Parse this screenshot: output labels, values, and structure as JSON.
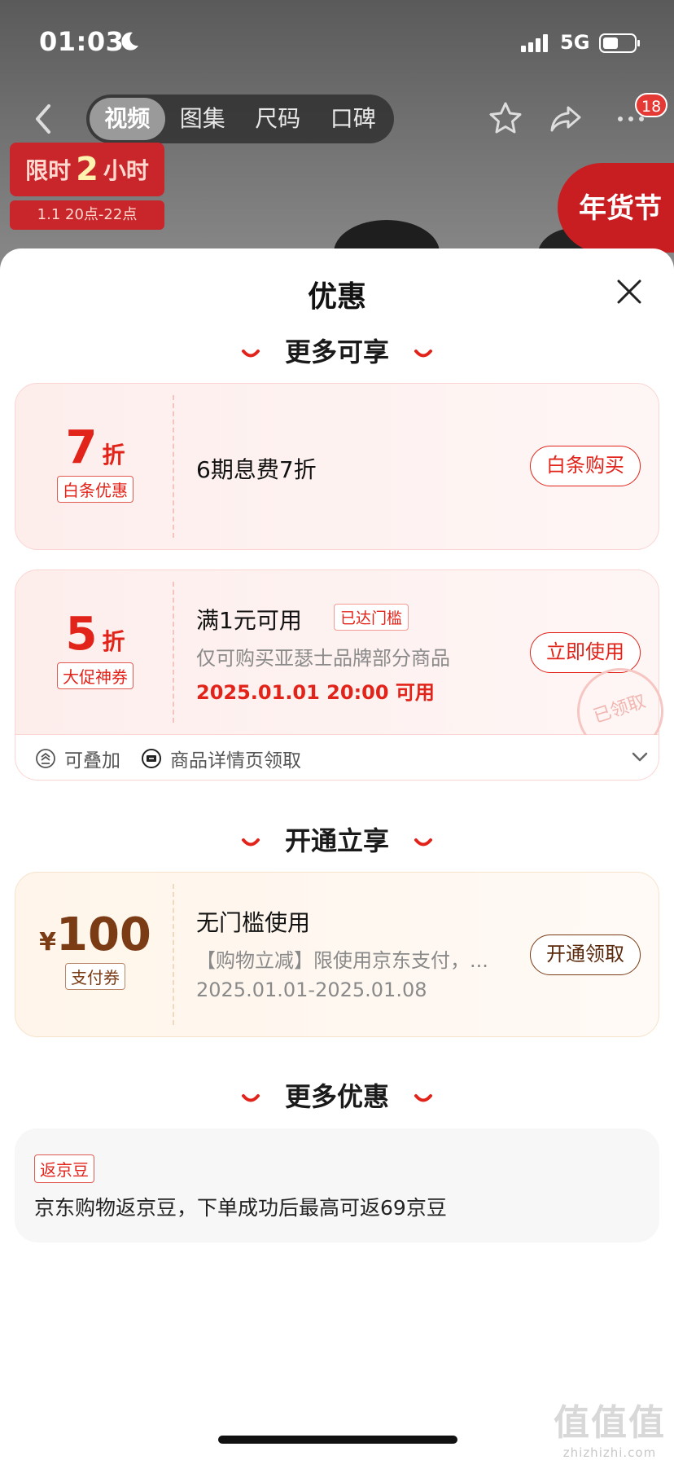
{
  "status_bar": {
    "time": "01:03",
    "network": "5G"
  },
  "nav": {
    "tabs": [
      "视频",
      "图集",
      "尺码",
      "口碑"
    ],
    "active_tab": "视频",
    "cart_badge": "18"
  },
  "promo": {
    "banner_prefix": "限时",
    "banner_number": "2",
    "banner_suffix": "小时",
    "time_range": "1.1 20点-22点",
    "festival": "年货节"
  },
  "sheet": {
    "title": "优惠",
    "sections": {
      "more_enjoy": "更多可享",
      "activate": "开通立享",
      "more_offers": "更多优惠"
    }
  },
  "coupons": {
    "baitiao": {
      "value": "7",
      "unit": "折",
      "tag": "白条优惠",
      "title": "6期息费7折",
      "action": "白条购买"
    },
    "promo": {
      "value": "5",
      "unit": "折",
      "tag": "大促神券",
      "title": "满1元可用",
      "threshold_tag": "已达门槛",
      "desc": "仅可购买亚瑟士品牌部分商品",
      "date": "2025.01.01 20:00 可用",
      "action": "立即使用",
      "stamp": "已领取",
      "footer_stackable": "可叠加",
      "footer_source": "商品详情页领取"
    },
    "payment": {
      "currency": "¥",
      "value": "100",
      "tag": "支付券",
      "title": "无门槛使用",
      "desc": "【购物立减】限使用京东支付，...",
      "date": "2025.01.01-2025.01.08",
      "action": "开通领取"
    }
  },
  "more_offers": {
    "tag": "返京豆",
    "text": "京东购物返京豆，下单成功后最高可返69京豆"
  },
  "watermark": {
    "glyphs": "值值值",
    "url": "zhizhizhi.com"
  },
  "colors": {
    "accent_red": "#e2231a",
    "brown": "#7a3b15"
  }
}
